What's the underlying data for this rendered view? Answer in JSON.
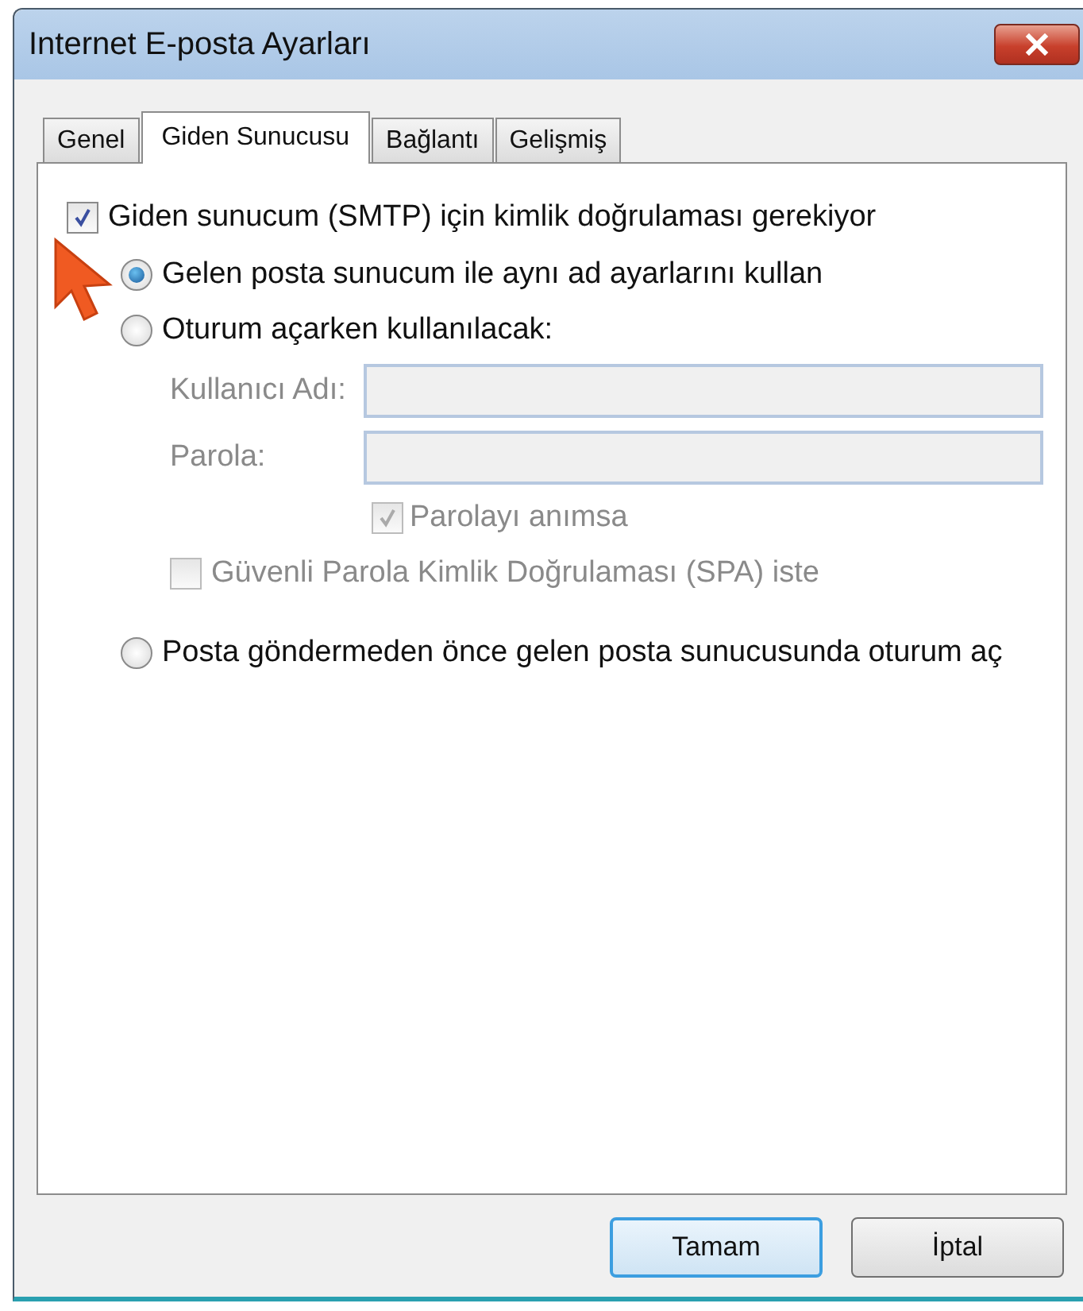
{
  "window": {
    "title": "Internet E-posta Ayarları"
  },
  "tabs": [
    {
      "label": "Genel",
      "selected": false
    },
    {
      "label": "Giden Sunucusu",
      "selected": true
    },
    {
      "label": "Bağlantı",
      "selected": false
    },
    {
      "label": "Gelişmiş",
      "selected": false
    }
  ],
  "settings": [
    {
      "kind": "checkbox",
      "label": "Giden sunucum (SMTP) için kimlik doğrulaması gerekiyor",
      "checked": true,
      "disabled": false,
      "children": [
        {
          "kind": "radio",
          "label": "Gelen posta sunucum ile aynı ad ayarlarını kullan",
          "selected": true,
          "disabled": false
        },
        {
          "kind": "radio",
          "label": "Oturum açarken kullanılacak:",
          "selected": false,
          "disabled": false,
          "children": [
            {
              "kind": "field",
              "label": "Kullanıcı Adı:",
              "disabled": true
            },
            {
              "kind": "field",
              "label": "Parola:",
              "disabled": true
            },
            {
              "kind": "field-checkbox",
              "label": "Parolayı anımsa",
              "checked": true,
              "disabled": true
            },
            {
              "kind": "checkbox",
              "label": "Güvenli Parola Kimlik Doğrulaması (SPA) iste",
              "checked": false,
              "disabled": true
            }
          ]
        },
        {
          "kind": "radio",
          "label": "Posta göndermeden önce gelen posta sunucusunda oturum aç",
          "selected": false,
          "disabled": false
        }
      ]
    }
  ],
  "buttons": [
    {
      "label": "Tamam",
      "default": true
    },
    {
      "label": "İptal",
      "default": false
    }
  ]
}
